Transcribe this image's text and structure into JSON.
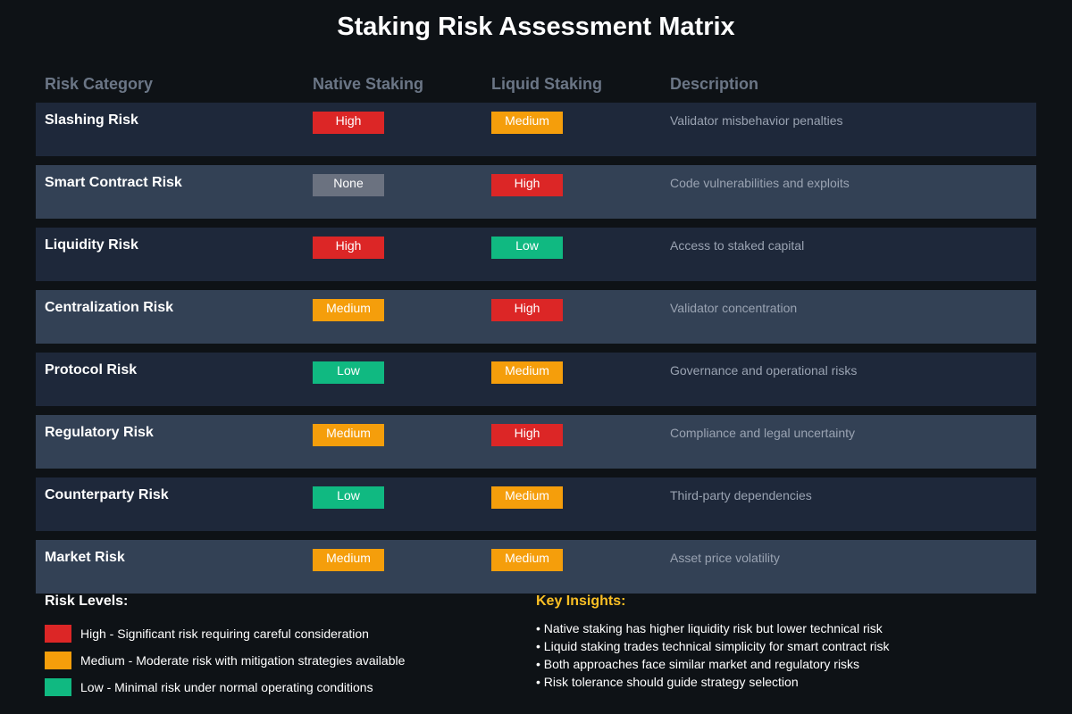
{
  "title": "Staking Risk Assessment Matrix",
  "colors": {
    "High": "#dc2626",
    "Medium": "#f59e0b",
    "Low": "#10b981",
    "None": "#6b7280",
    "insights_title": "#fbbf24"
  },
  "chart_data": {
    "type": "table",
    "title": "Staking Risk Assessment Matrix",
    "columns": [
      "Risk Category",
      "Native Staking",
      "Liquid Staking",
      "Description"
    ],
    "rows": [
      {
        "category": "Slashing Risk",
        "native": "High",
        "liquid": "Medium",
        "description": "Validator misbehavior penalties"
      },
      {
        "category": "Smart Contract Risk",
        "native": "None",
        "liquid": "High",
        "description": "Code vulnerabilities and exploits"
      },
      {
        "category": "Liquidity Risk",
        "native": "High",
        "liquid": "Low",
        "description": "Access to staked capital"
      },
      {
        "category": "Centralization Risk",
        "native": "Medium",
        "liquid": "High",
        "description": "Validator concentration"
      },
      {
        "category": "Protocol Risk",
        "native": "Low",
        "liquid": "Medium",
        "description": "Governance and operational risks"
      },
      {
        "category": "Regulatory Risk",
        "native": "Medium",
        "liquid": "High",
        "description": "Compliance and legal uncertainty"
      },
      {
        "category": "Counterparty Risk",
        "native": "Low",
        "liquid": "Medium",
        "description": "Third-party dependencies"
      },
      {
        "category": "Market Risk",
        "native": "Medium",
        "liquid": "Medium",
        "description": "Asset price volatility"
      }
    ]
  },
  "legend": {
    "title": "Risk Levels:",
    "items": [
      {
        "level": "High",
        "text": "High - Significant risk requiring careful consideration"
      },
      {
        "level": "Medium",
        "text": "Medium - Moderate risk with mitigation strategies available"
      },
      {
        "level": "Low",
        "text": "Low - Minimal risk under normal operating conditions"
      }
    ]
  },
  "insights": {
    "title": "Key Insights:",
    "items": [
      "• Native staking has higher liquidity risk but lower technical risk",
      "• Liquid staking trades technical simplicity for smart contract risk",
      "• Both approaches face similar market and regulatory risks",
      "• Risk tolerance should guide strategy selection"
    ]
  }
}
